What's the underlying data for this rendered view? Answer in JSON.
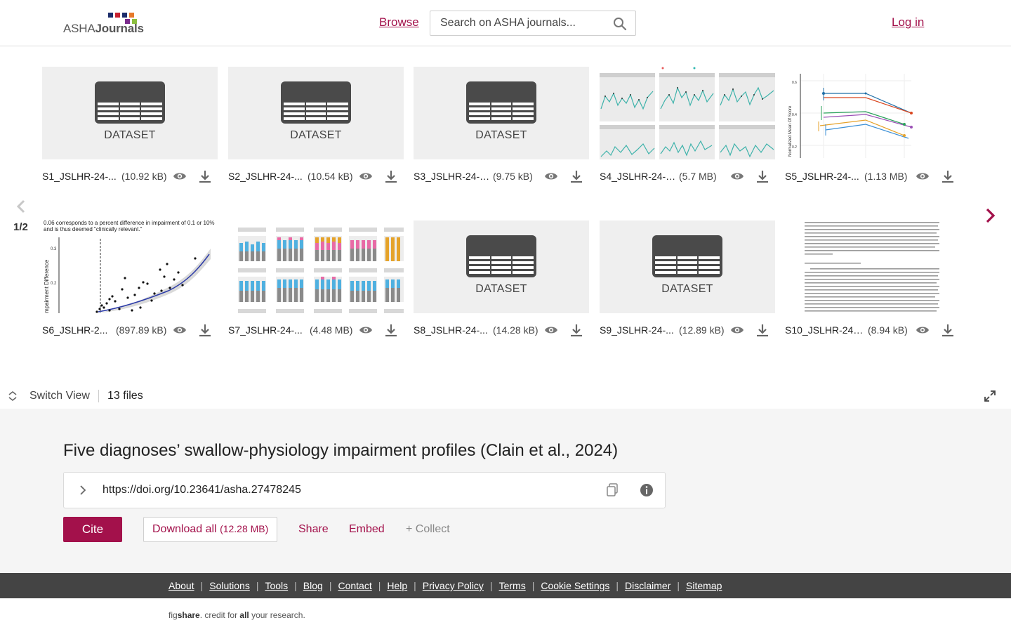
{
  "header": {
    "logo_prefix": "ASHA",
    "logo_suffix": "Journals",
    "browse_label": "Browse",
    "search_placeholder": "Search on ASHA journals...",
    "login_label": "Log in"
  },
  "gallery": {
    "page_indicator": "1/2",
    "files": [
      {
        "name": "S1_JSLHR-24-...",
        "size": "(10.92 kB)",
        "thumb": "DATASET"
      },
      {
        "name": "S2_JSLHR-24-...",
        "size": "(10.54 kB)",
        "thumb": "DATASET"
      },
      {
        "name": "S3_JSLHR-24-0...",
        "size": "(9.75 kB)",
        "thumb": "DATASET"
      },
      {
        "name": "S4_JSLHR-24-0...",
        "size": "(5.7 MB)",
        "thumb": ""
      },
      {
        "name": "S5_JSLHR-24-...",
        "size": "(1.13 MB)",
        "thumb": ""
      },
      {
        "name": "S6_JSLHR-2...",
        "size": "(897.89 kB)",
        "thumb": ""
      },
      {
        "name": "S7_JSLHR-24-...",
        "size": "(4.48 MB)",
        "thumb": ""
      },
      {
        "name": "S8_JSLHR-24-...",
        "size": "(14.28 kB)",
        "thumb": "DATASET"
      },
      {
        "name": "S9_JSLHR-24-...",
        "size": "(12.89 kB)",
        "thumb": "DATASET"
      },
      {
        "name": "S10_JSLHR-24-...",
        "size": "(8.94 kB)",
        "thumb": ""
      }
    ],
    "s6_caption_line1": "0.06 corresponds to a percent difference in impairment of 0.1 or 10%",
    "s6_caption_line2": "and is thus deemed \"clinically relevant.\"",
    "s6_ylabel": "mpairment Difference",
    "s5_ylabel": "Normalized Mean Of Score"
  },
  "toolbar": {
    "switch_view_label": "Switch View",
    "file_count": "13 files"
  },
  "details": {
    "title": "Five diagnoses’ swallow-physiology impairment profiles (Clain et al., 2024)",
    "doi": "https://doi.org/10.23641/asha.27478245",
    "cite_label": "Cite",
    "download_all_label": "Download all",
    "download_all_size": "(12.28 MB)",
    "share_label": "Share",
    "embed_label": "Embed",
    "collect_label": "+ Collect"
  },
  "footer": {
    "links": [
      "About",
      "Solutions",
      "Tools",
      "Blog",
      "Contact",
      "Help",
      "Privacy Policy",
      "Terms",
      "Cookie Settings",
      "Disclaimer",
      "Sitemap"
    ],
    "credit_fig": "fig",
    "credit_share": "share",
    "credit_mid": ". credit for ",
    "credit_all": "all",
    "credit_end": " your research."
  },
  "colors": {
    "brand": "#a3114b",
    "footer_bg": "#444444",
    "details_bg": "#f5f5f5"
  },
  "icons": [
    "search-icon",
    "eye-icon",
    "download-icon",
    "chevron-left-icon",
    "chevron-right-icon",
    "switch-view-icon",
    "expand-icon",
    "copy-icon",
    "info-icon",
    "dataset-icon"
  ]
}
